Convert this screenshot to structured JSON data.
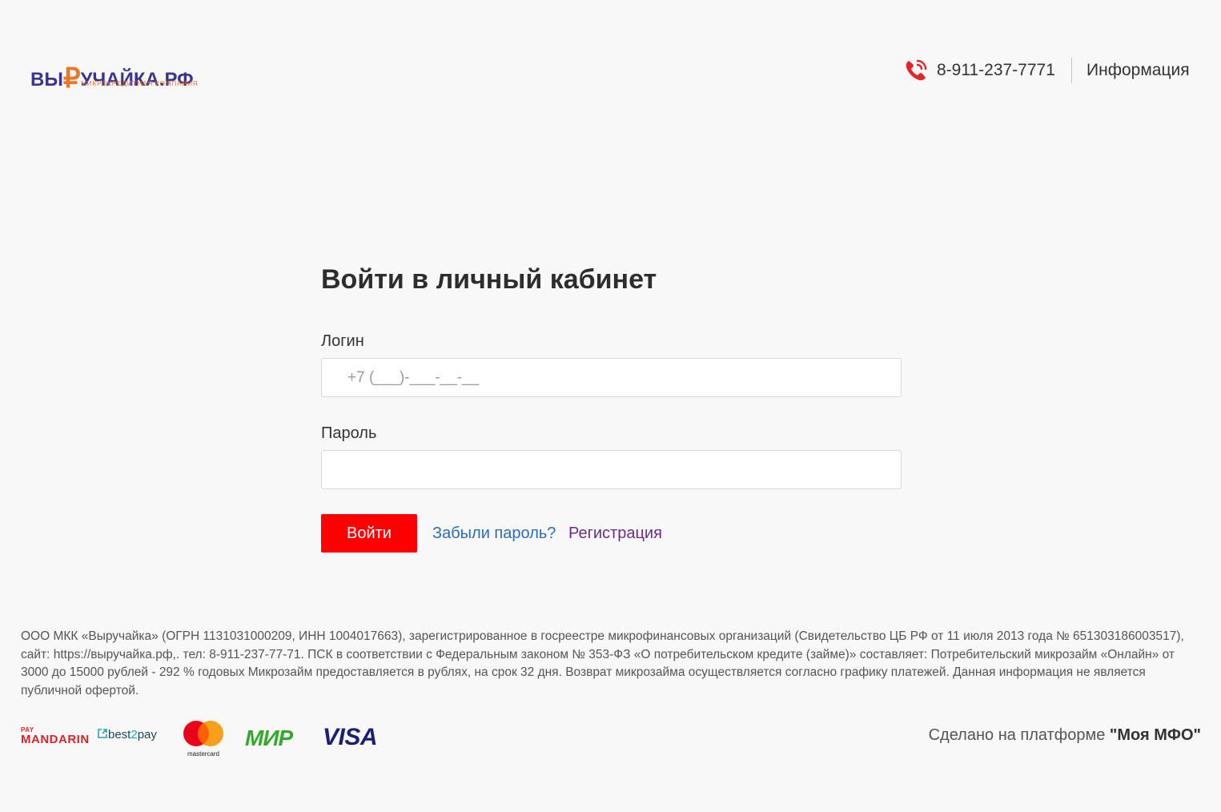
{
  "header": {
    "logo_wordmark_left": "ВЫ",
    "logo_wordmark_ruble": "₽",
    "logo_wordmark_right": "УЧАЙКА.РФ",
    "logo_tagline": "МИКРОКРЕДИТНАЯ КОМПАНИЯ",
    "phone": "8-911-237-7771",
    "info_label": "Информация",
    "brand_color": "#3a3593",
    "accent_color": "#e8772a"
  },
  "login": {
    "title": "Войти в личный кабинет",
    "login_label": "Логин",
    "login_placeholder": "+7 (___)-___-__-__",
    "login_value": "",
    "password_label": "Пароль",
    "password_value": "",
    "submit_label": "Войти",
    "forgot_label": "Забыли пароль?",
    "register_label": "Регистрация",
    "submit_color": "#ff0000"
  },
  "footer": {
    "disclaimer": "ООО МКК «Выручайка» (ОГРН 1131031000209, ИНН 1004017663), зарегистрированное в госреестре микрофинансовых организаций (Свидетельство ЦБ РФ от 11 июля 2013 года № 651303186003517), сайт: https://выручайка.рф,. тел: 8-911-237-77-71. ПСК в соответствии с Федеральным законом № 353-ФЗ «О потребительском кредите (займе)» составляет: Потребительский микрозайм «Онлайн» от 3000 до 15000 рублей - 292 % годовых Микрозайм предоставляется в рублях, на срок 32 дня. Возврат микрозайма осуществляется согласно графику платежей. Данная информация не является публичной офертой.",
    "payments": {
      "mandarin_small": "PAY",
      "mandarin_big": "MANDARIN",
      "best2pay_a": "best",
      "best2pay_b": "2",
      "best2pay_c": "pay",
      "mastercard": "mastercard",
      "mir": "МИР",
      "visa": "VISA"
    },
    "platform_prefix": "Сделано на платформе ",
    "platform_name": "\"Моя МФО\""
  }
}
